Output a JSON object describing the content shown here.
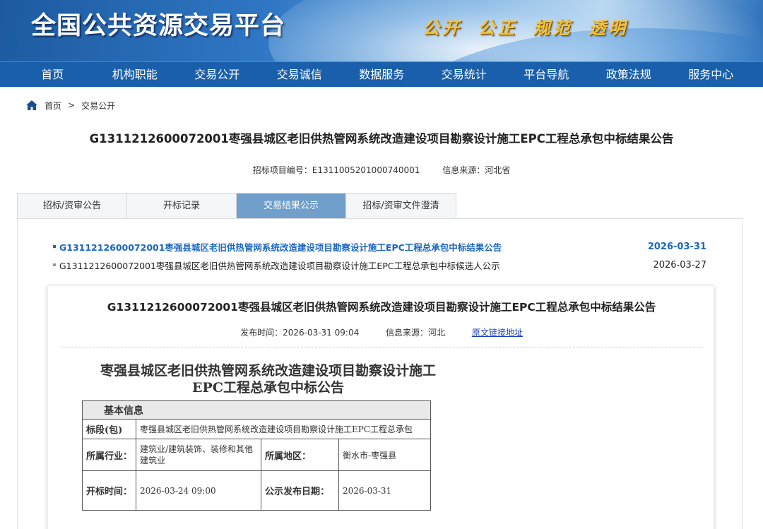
{
  "banner": {
    "title": "全国公共资源交易平台",
    "slogan": "公开 公正 规范 透明"
  },
  "nav": {
    "items": [
      "首页",
      "机构职能",
      "交易公开",
      "交易诚信",
      "数据服务",
      "交易统计",
      "平台导航",
      "政策法规",
      "服务中心"
    ]
  },
  "breadcrumb": {
    "home": "首页",
    "separator": ">",
    "current": "交易公开"
  },
  "page": {
    "title": "G1311212600072001枣强县城区老旧供热管网系统改造建设项目勘察设计施工EPC工程总承包中标结果公告",
    "project_no": "招标项目编号：E1311005201000740001",
    "source": "信息来源：河北省"
  },
  "tabs": [
    "招标/资审公告",
    "开标记录",
    "交易结果公示",
    "招标/资审文件澄清"
  ],
  "list": [
    {
      "title": "G1311212600072001枣强县城区老旧供热管网系统改造建设项目勘察设计施工EPC工程总承包中标结果公告",
      "date": "2026-03-31"
    },
    {
      "title": "G1311212600072001枣强县城区老旧供热管网系统改造建设项目勘察设计施工EPC工程总承包中标候选人公示",
      "date": "2026-03-27"
    }
  ],
  "card": {
    "title": "G1311212600072001枣强县城区老旧供热管网系统改造建设项目勘察设计施工EPC工程总承包中标结果公告",
    "publish_time": "发布时间：2026-03-31 09:04",
    "source": "信息来源：河北",
    "link": "原文链接地址"
  },
  "doc": {
    "title_line1": "枣强县城区老旧供热管网系统改造建设项目勘察设计施工",
    "title_line2": "EPC工程总承包中标公告",
    "section": "基本信息",
    "rows": {
      "segment_label": "标段(包)",
      "segment_value": "枣强县城区老旧供热管网系统改造建设项目勘察设计施工EPC工程总承包",
      "industry_label": "所属行业：",
      "industry_value": "建筑业/建筑装饰、装修和其他建筑业",
      "region_label": "所属地区：",
      "region_value": "衡水市-枣强县",
      "open_label": "开标时间：",
      "open_value": "2026-03-24 09:00",
      "pub_label": "公示发布日期：",
      "pub_value": "2026-03-31"
    }
  }
}
